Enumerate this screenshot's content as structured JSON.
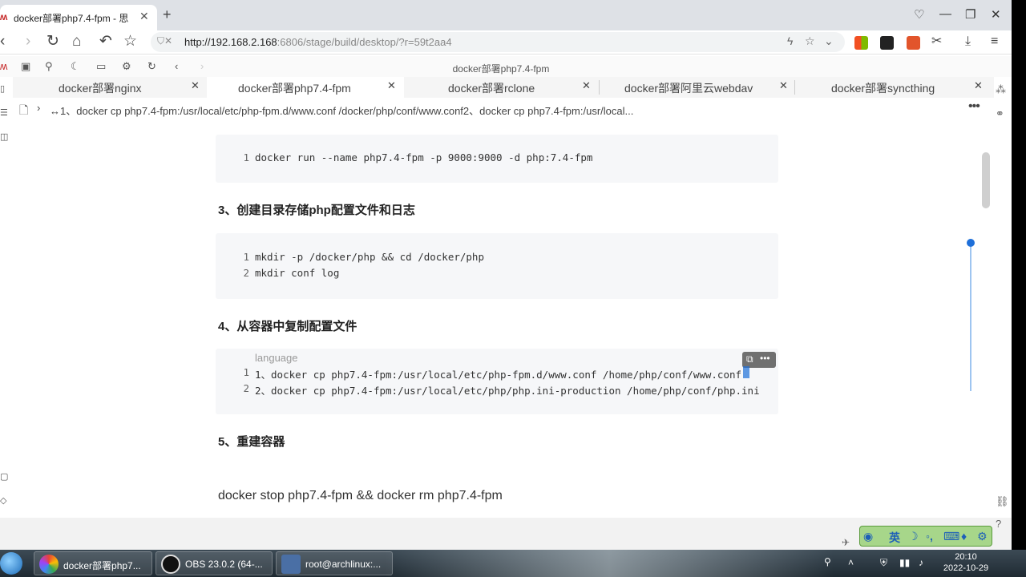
{
  "browser": {
    "tab_title": "docker部署php7.4-fpm - 思",
    "new_tab": "+",
    "url_host": "http://192.168.2.168",
    "url_rest": ":6806/stage/build/desktop/?r=59t2aa4"
  },
  "app": {
    "window_title": "docker部署php7.4-fpm",
    "doc_tabs": [
      {
        "label": "docker部署nginx"
      },
      {
        "label": "docker部署php7.4-fpm"
      },
      {
        "label": "docker部署rclone"
      },
      {
        "label": "docker部署阿里云webdav"
      },
      {
        "label": "docker部署syncthing"
      }
    ],
    "breadcrumb": "↔1、docker cp php7.4-fpm:/usr/local/etc/php-fpm.d/www.conf /docker/php/conf/www.conf2、docker cp php7.4-fpm:/usr/local..."
  },
  "content": {
    "block1": {
      "lines": [
        {
          "num": "1",
          "text": "docker run --name php7.4-fpm -p 9000:9000 -d php:7.4-fpm"
        }
      ]
    },
    "heading3": "3、创建目录存储php配置文件和日志",
    "block2": {
      "lines": [
        {
          "num": "1",
          "text": "mkdir -p /docker/php && cd /docker/php"
        },
        {
          "num": "2",
          "text": "mkdir conf log"
        }
      ]
    },
    "heading4": "4、从容器中复制配置文件",
    "block3": {
      "language": "language",
      "lines": [
        {
          "num": "1",
          "text": "1、docker cp php7.4-fpm:/usr/local/etc/php-fpm.d/www.conf /home/php/conf/www.conf"
        },
        {
          "num": "2",
          "text": "2、docker cp php7.4-fpm:/usr/local/etc/php/php.ini-production /home/php/conf/php.ini"
        }
      ]
    },
    "heading5": "5、重建容器",
    "paragraph": "docker stop php7.4-fpm && docker rm php7.4-fpm"
  },
  "ime": {
    "mode": "英"
  },
  "taskbar": {
    "items": [
      {
        "label": "docker部署php7..."
      },
      {
        "label": "OBS 23.0.2 (64-..."
      },
      {
        "label": "root@archlinux:..."
      }
    ],
    "time": "20:10",
    "date": "2022-10-29"
  }
}
